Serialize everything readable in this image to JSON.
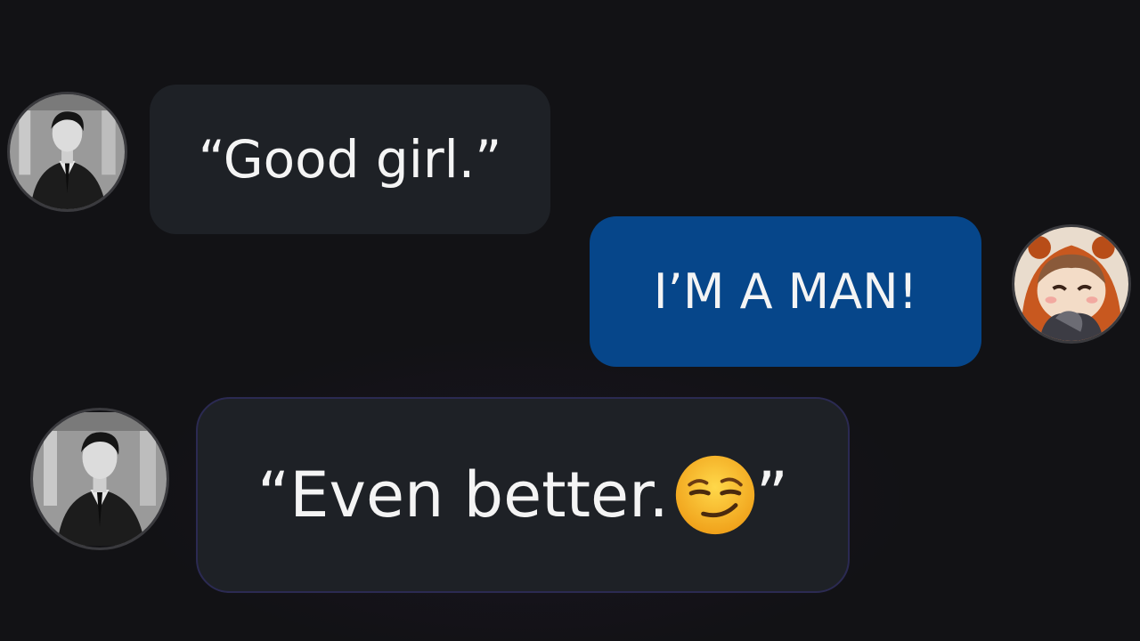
{
  "conversation": {
    "messages": [
      {
        "sender": "them",
        "avatar_icon": "man-in-suit-avatar",
        "text": "“Good girl.”"
      },
      {
        "sender": "me",
        "avatar_icon": "anime-girl-orange-hood-avatar",
        "text": "I’M A MAN!"
      },
      {
        "sender": "them",
        "avatar_icon": "man-in-suit-avatar",
        "text_before": "“Even better.",
        "emoji": "smirking-face-icon",
        "text_after": "”"
      }
    ]
  },
  "colors": {
    "background": "#121215",
    "incoming_bubble": "#1e2126",
    "outgoing_bubble": "#06468a",
    "text": "#f4f4f4"
  }
}
